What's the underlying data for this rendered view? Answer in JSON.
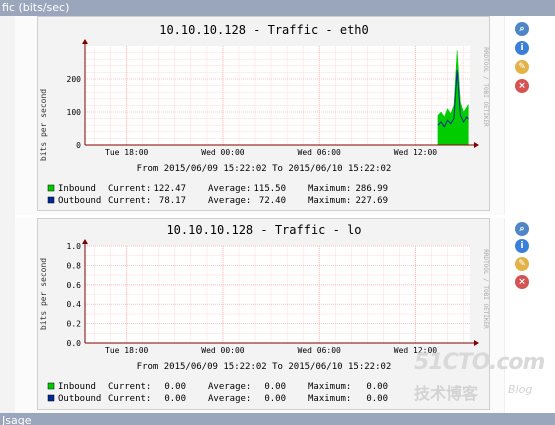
{
  "header": {
    "top_label": "fic (bits/sec)",
    "bottom_label": "Jsage"
  },
  "colors": {
    "inbound": "#00cc00",
    "outbound": "#002a97",
    "grid_major": "#ffb0b0",
    "grid_minor": "#ffe0e0",
    "axis": "#800000"
  },
  "graphs": [
    {
      "title": "10.10.10.128 - Traffic - eth0",
      "ylabel": "bits per second",
      "side_text": "RRDTOOL / TOBI OETIKER",
      "x_ticks": [
        "Tue 18:00",
        "Wed 00:00",
        "Wed 06:00",
        "Wed 12:00"
      ],
      "y_ticks": [
        "0",
        "100",
        "200"
      ],
      "range": "From 2015/06/09 15:22:02 To 2015/06/10 15:22:02",
      "legend": {
        "inbound": {
          "name": "Inbound",
          "current": "Current:",
          "current_val": "122.47",
          "average": "Average:",
          "average_val": "115.50",
          "maximum": "Maximum:",
          "maximum_val": "286.99"
        },
        "outbound": {
          "name": "Outbound",
          "current": "Current:",
          "current_val": "78.17",
          "average": "Average:",
          "average_val": "72.40",
          "maximum": "Maximum:",
          "maximum_val": "227.69"
        }
      }
    },
    {
      "title": "10.10.10.128 - Traffic - lo",
      "ylabel": "bits per second",
      "side_text": "RRDTOOL / TOBI OETIKER",
      "x_ticks": [
        "Tue 18:00",
        "Wed 00:00",
        "Wed 06:00",
        "Wed 12:00"
      ],
      "y_ticks": [
        "0.0",
        "0.2",
        "0.4",
        "0.6",
        "0.8",
        "1.0"
      ],
      "range": "From 2015/06/09 15:22:02 To 2015/06/10 15:22:02",
      "legend": {
        "inbound": {
          "name": "Inbound",
          "current": "Current:",
          "current_val": "0.00",
          "average": "Average:",
          "average_val": "0.00",
          "maximum": "Maximum:",
          "maximum_val": "0.00"
        },
        "outbound": {
          "name": "Outbound",
          "current": "Current:",
          "current_val": "0.00",
          "average": "Average:",
          "average_val": "0.00",
          "maximum": "Maximum:",
          "maximum_val": "0.00"
        }
      }
    }
  ],
  "chart_data": [
    {
      "type": "area",
      "title": "10.10.10.128 - Traffic - eth0",
      "ylabel": "bits per second",
      "ylim": [
        0,
        300
      ],
      "x_ticks": [
        "Tue 18:00",
        "Wed 00:00",
        "Wed 06:00",
        "Wed 12:00"
      ],
      "x_hours": [
        15.4,
        18,
        24,
        30,
        36,
        39.4
      ],
      "series": [
        {
          "name": "Inbound",
          "color": "#00cc00",
          "x": [
            37.4,
            37.6,
            37.8,
            38.0,
            38.2,
            38.4,
            38.6,
            38.8,
            39.0,
            39.2,
            39.3
          ],
          "y": [
            90,
            100,
            85,
            110,
            95,
            120,
            286.99,
            130,
            100,
            115,
            122.47
          ]
        },
        {
          "name": "Outbound",
          "color": "#002a97",
          "x": [
            37.4,
            37.6,
            37.8,
            38.0,
            38.2,
            38.4,
            38.6,
            38.8,
            39.0,
            39.2,
            39.3
          ],
          "y": [
            60,
            70,
            55,
            75,
            65,
            80,
            227.69,
            90,
            70,
            85,
            78.17
          ]
        }
      ]
    },
    {
      "type": "line",
      "title": "10.10.10.128 - Traffic - lo",
      "ylabel": "bits per second",
      "ylim": [
        0,
        1.0
      ],
      "x_ticks": [
        "Tue 18:00",
        "Wed 00:00",
        "Wed 06:00",
        "Wed 12:00"
      ],
      "series": [
        {
          "name": "Inbound",
          "color": "#00cc00",
          "x": [
            15.4,
            39.4
          ],
          "y": [
            0,
            0
          ]
        },
        {
          "name": "Outbound",
          "color": "#002a97",
          "x": [
            15.4,
            39.4
          ],
          "y": [
            0,
            0
          ]
        }
      ]
    }
  ],
  "watermark": {
    "main": "51CTO.com",
    "sub": "技术博客",
    "blog": "Blog"
  }
}
